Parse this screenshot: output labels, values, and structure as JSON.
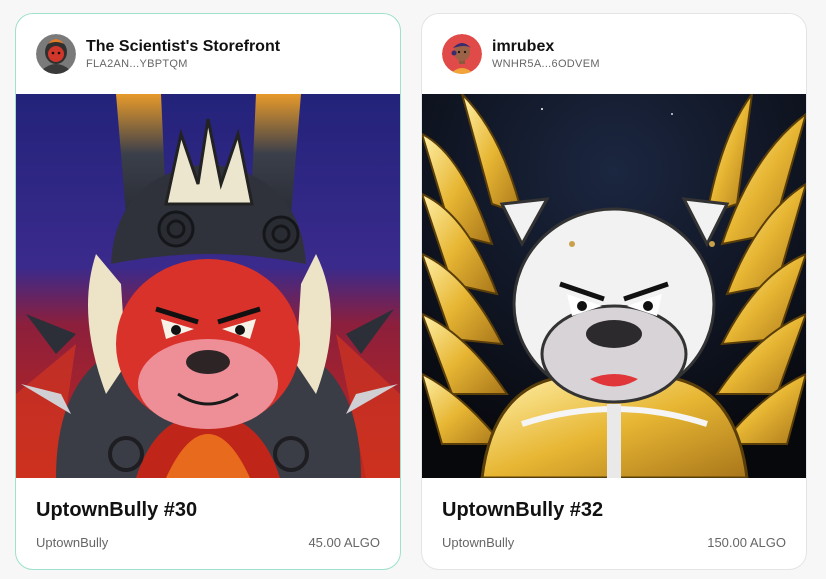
{
  "cards": [
    {
      "owner": "The Scientist's Storefront",
      "address": "FLA2AN...YBPTQM",
      "title": "UptownBully #30",
      "collection": "UptownBully",
      "price": "45.00 ALGO",
      "avatar_icon": "red-bulldog-avatar-icon",
      "artwork": "red-bulldog-warrior-artwork",
      "selected": true
    },
    {
      "owner": "imrubex",
      "address": "WNHR5A...6ODVEM",
      "title": "UptownBully #32",
      "collection": "UptownBully",
      "price": "150.00 ALGO",
      "avatar_icon": "cartoon-person-avatar-icon",
      "artwork": "white-bulldog-golden-wings-artwork",
      "selected": false
    }
  ],
  "colors": {
    "selected_border": "#9ee0cd",
    "card_border": "#e4e4e7",
    "background": "#f7f7f8"
  }
}
